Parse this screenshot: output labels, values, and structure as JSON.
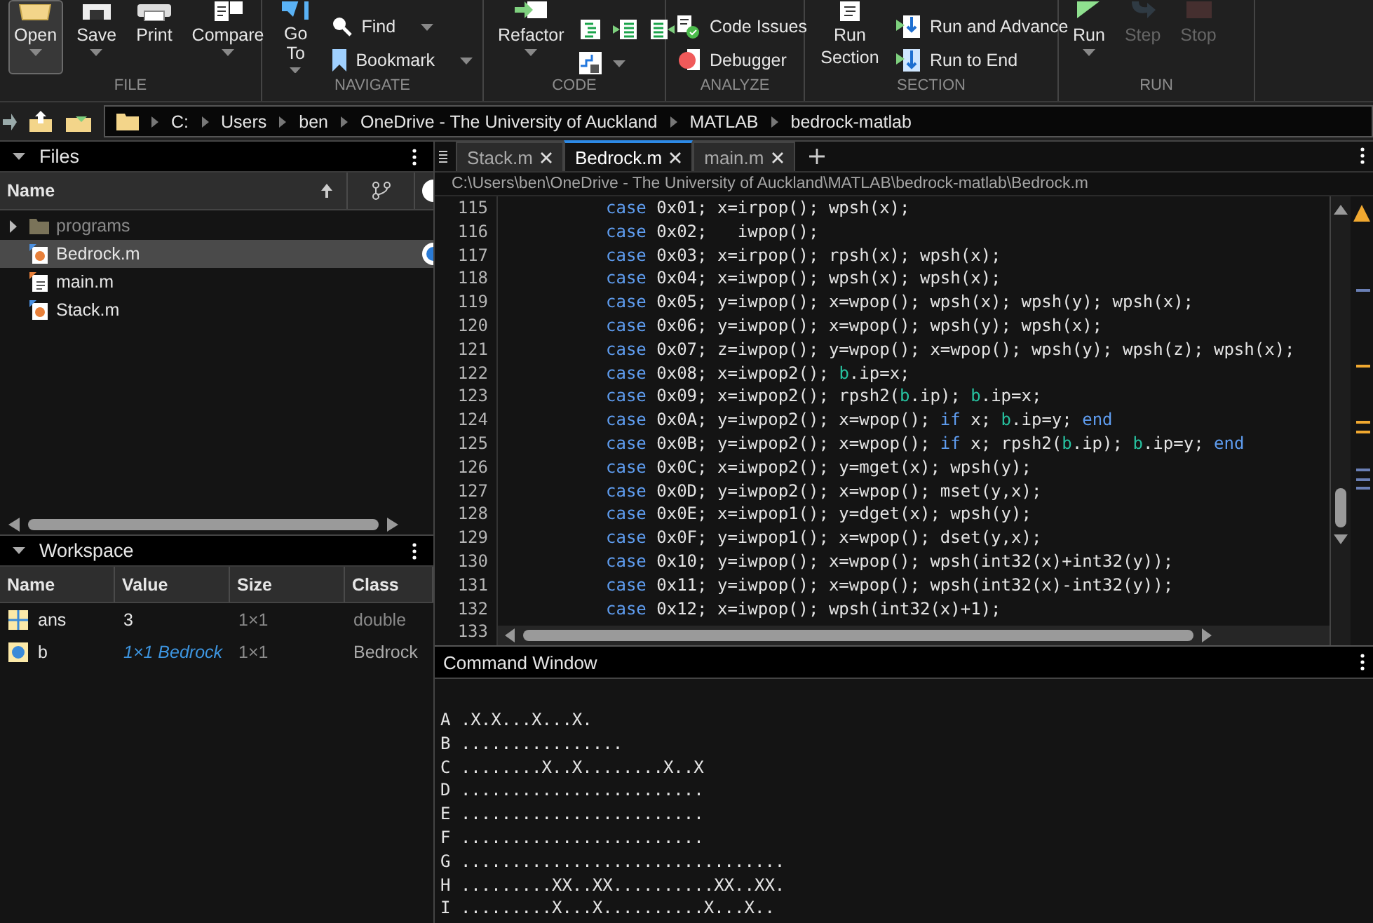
{
  "ribbon": {
    "sections": [
      {
        "label": "FILE",
        "items": [
          {
            "label": "Open",
            "kind": "large",
            "selected": true,
            "dropdown": true,
            "disabled": false
          },
          {
            "label": "Save",
            "kind": "large",
            "selected": false,
            "dropdown": true,
            "disabled": false
          },
          {
            "label": "Print",
            "kind": "large",
            "selected": false,
            "dropdown": false,
            "disabled": false
          },
          {
            "label": "Compare",
            "kind": "large",
            "selected": false,
            "dropdown": true,
            "disabled": false
          }
        ]
      },
      {
        "label": "NAVIGATE",
        "items": [
          {
            "label": "Go To",
            "kind": "large",
            "selected": false,
            "dropdown": true,
            "disabled": false
          },
          {
            "label": "Find",
            "kind": "small",
            "selected": false,
            "dropdown": true,
            "disabled": false
          },
          {
            "label": "Bookmark",
            "kind": "small",
            "selected": false,
            "dropdown": true,
            "disabled": false
          }
        ]
      },
      {
        "label": "CODE",
        "items": [
          {
            "label": "Refactor",
            "kind": "large",
            "selected": false,
            "dropdown": true,
            "disabled": false
          },
          {
            "kind": "tools",
            "dropdown": true
          }
        ]
      },
      {
        "label": "ANALYZE",
        "items": [
          {
            "label": "Code Issues",
            "kind": "small",
            "selected": false,
            "dropdown": false,
            "disabled": false
          },
          {
            "label": "Debugger",
            "kind": "small",
            "selected": false,
            "dropdown": false,
            "disabled": false
          }
        ]
      },
      {
        "label": "SECTION",
        "items": [
          {
            "label": "Run Section",
            "kind": "large",
            "selected": false,
            "dropdown": false,
            "disabled": false
          },
          {
            "label": "Run and Advance",
            "kind": "small",
            "selected": false,
            "dropdown": false,
            "disabled": false
          },
          {
            "label": "Run to End",
            "kind": "small",
            "selected": false,
            "dropdown": false,
            "disabled": false
          }
        ]
      },
      {
        "label": "RUN",
        "items": [
          {
            "label": "Run",
            "kind": "large",
            "selected": false,
            "dropdown": true,
            "disabled": false
          },
          {
            "label": "Step",
            "kind": "large",
            "selected": false,
            "dropdown": false,
            "disabled": true
          },
          {
            "label": "Stop",
            "kind": "large",
            "selected": false,
            "dropdown": false,
            "disabled": true
          }
        ]
      }
    ]
  },
  "path": {
    "segments": [
      "C:",
      "Users",
      "ben",
      "OneDrive - The University of Auckland",
      "MATLAB",
      "bedrock-matlab"
    ]
  },
  "files": {
    "title": "Files",
    "column": "Name",
    "items": [
      {
        "name": "programs",
        "kind": "folder",
        "selected": false,
        "dimmed": true,
        "expanded": false
      },
      {
        "name": "Bedrock.m",
        "kind": "class",
        "selected": true,
        "dimmed": false
      },
      {
        "name": "main.m",
        "kind": "script",
        "selected": false,
        "dimmed": false
      },
      {
        "name": "Stack.m",
        "kind": "class",
        "selected": false,
        "dimmed": false
      }
    ]
  },
  "workspace": {
    "title": "Workspace",
    "columns": [
      "Name",
      "Value",
      "Size",
      "Class"
    ],
    "rows": [
      {
        "kind": "matrix",
        "name": "ans",
        "value": "3",
        "size": "1×1",
        "class": "double"
      },
      {
        "kind": "object",
        "name": "b",
        "value": "1×1 Bedrock",
        "size": "1×1",
        "class": "Bedrock"
      }
    ]
  },
  "editor": {
    "tabs": [
      {
        "label": "Stack.m",
        "selected": false
      },
      {
        "label": "Bedrock.m",
        "selected": true
      },
      {
        "label": "main.m",
        "selected": false
      }
    ],
    "path": "C:\\Users\\ben\\OneDrive - The University of Auckland\\MATLAB\\bedrock-matlab\\Bedrock.m",
    "lines": [
      {
        "number": "115",
        "tokens": [
          {
            "kind": "keyword",
            "text": "case"
          },
          {
            "kind": "plain",
            "text": " 0x01; x=irpop(); wpsh(x);"
          }
        ]
      },
      {
        "number": "116",
        "tokens": [
          {
            "kind": "keyword",
            "text": "case"
          },
          {
            "kind": "plain",
            "text": " 0x02;   iwpop();"
          }
        ]
      },
      {
        "number": "117",
        "tokens": [
          {
            "kind": "keyword",
            "text": "case"
          },
          {
            "kind": "plain",
            "text": " 0x03; x=irpop(); rpsh(x); wpsh(x);"
          }
        ]
      },
      {
        "number": "118",
        "tokens": [
          {
            "kind": "keyword",
            "text": "case"
          },
          {
            "kind": "plain",
            "text": " 0x04; x=iwpop(); wpsh(x); wpsh(x);"
          }
        ]
      },
      {
        "number": "119",
        "tokens": [
          {
            "kind": "keyword",
            "text": "case"
          },
          {
            "kind": "plain",
            "text": " 0x05; y=iwpop(); x=wpop(); wpsh(x); wpsh(y); wpsh(x);"
          }
        ]
      },
      {
        "number": "120",
        "tokens": [
          {
            "kind": "keyword",
            "text": "case"
          },
          {
            "kind": "plain",
            "text": " 0x06; y=iwpop(); x=wpop(); wpsh(y); wpsh(x);"
          }
        ]
      },
      {
        "number": "121",
        "tokens": [
          {
            "kind": "keyword",
            "text": "case"
          },
          {
            "kind": "plain",
            "text": " 0x07; z=iwpop(); y=wpop(); x=wpop(); wpsh(y); wpsh(z); wpsh(x);"
          }
        ]
      },
      {
        "number": "122",
        "tokens": [
          {
            "kind": "keyword",
            "text": "case"
          },
          {
            "kind": "plain",
            "text": " 0x08; x=iwpop2(); "
          },
          {
            "kind": "object",
            "text": "b"
          },
          {
            "kind": "plain",
            "text": ".ip=x;"
          }
        ]
      },
      {
        "number": "123",
        "tokens": [
          {
            "kind": "keyword",
            "text": "case"
          },
          {
            "kind": "plain",
            "text": " 0x09; x=iwpop2(); rpsh2("
          },
          {
            "kind": "object",
            "text": "b"
          },
          {
            "kind": "plain",
            "text": ".ip); "
          },
          {
            "kind": "object",
            "text": "b"
          },
          {
            "kind": "plain",
            "text": ".ip=x;"
          }
        ]
      },
      {
        "number": "124",
        "tokens": [
          {
            "kind": "keyword",
            "text": "case"
          },
          {
            "kind": "plain",
            "text": " 0x0A; y=iwpop2(); x=wpop(); "
          },
          {
            "kind": "keyword",
            "text": "if"
          },
          {
            "kind": "plain",
            "text": " x; "
          },
          {
            "kind": "object",
            "text": "b"
          },
          {
            "kind": "plain",
            "text": ".ip=y; "
          },
          {
            "kind": "keyword",
            "text": "end"
          }
        ]
      },
      {
        "number": "125",
        "tokens": [
          {
            "kind": "keyword",
            "text": "case"
          },
          {
            "kind": "plain",
            "text": " 0x0B; y=iwpop2(); x=wpop(); "
          },
          {
            "kind": "keyword",
            "text": "if"
          },
          {
            "kind": "plain",
            "text": " x; rpsh2("
          },
          {
            "kind": "object",
            "text": "b"
          },
          {
            "kind": "plain",
            "text": ".ip); "
          },
          {
            "kind": "object",
            "text": "b"
          },
          {
            "kind": "plain",
            "text": ".ip=y; "
          },
          {
            "kind": "keyword",
            "text": "end"
          }
        ]
      },
      {
        "number": "126",
        "tokens": [
          {
            "kind": "keyword",
            "text": "case"
          },
          {
            "kind": "plain",
            "text": " 0x0C; x=iwpop2(); y=mget(x); wpsh(y);"
          }
        ]
      },
      {
        "number": "127",
        "tokens": [
          {
            "kind": "keyword",
            "text": "case"
          },
          {
            "kind": "plain",
            "text": " 0x0D; y=iwpop2(); x=wpop(); mset(y,x);"
          }
        ]
      },
      {
        "number": "128",
        "tokens": [
          {
            "kind": "keyword",
            "text": "case"
          },
          {
            "kind": "plain",
            "text": " 0x0E; x=iwpop1(); y=dget(x); wpsh(y);"
          }
        ]
      },
      {
        "number": "129",
        "tokens": [
          {
            "kind": "keyword",
            "text": "case"
          },
          {
            "kind": "plain",
            "text": " 0x0F; y=iwpop1(); x=wpop(); dset(y,x);"
          }
        ]
      },
      {
        "number": "130",
        "tokens": [
          {
            "kind": "keyword",
            "text": "case"
          },
          {
            "kind": "plain",
            "text": " 0x10; y=iwpop(); x=wpop(); wpsh(int32(x)+int32(y));"
          }
        ]
      },
      {
        "number": "131",
        "tokens": [
          {
            "kind": "keyword",
            "text": "case"
          },
          {
            "kind": "plain",
            "text": " 0x11; y=iwpop(); x=wpop(); wpsh(int32(x)-int32(y));"
          }
        ]
      },
      {
        "number": "132",
        "tokens": [
          {
            "kind": "keyword",
            "text": "case"
          },
          {
            "kind": "plain",
            "text": " 0x12; x=iwpop(); wpsh(int32(x)+1);"
          }
        ]
      },
      {
        "number": "133"
      }
    ]
  },
  "command_window": {
    "title": "Command Window",
    "lines": [
      "A .X.X...X...X.",
      "B ................",
      "C ........X..X........X..X",
      "D ........................",
      "E ........................",
      "F ........................",
      "G ................................",
      "H .........XX..XX..........XX..XX.",
      "I .........X...X..........X...X.."
    ]
  }
}
